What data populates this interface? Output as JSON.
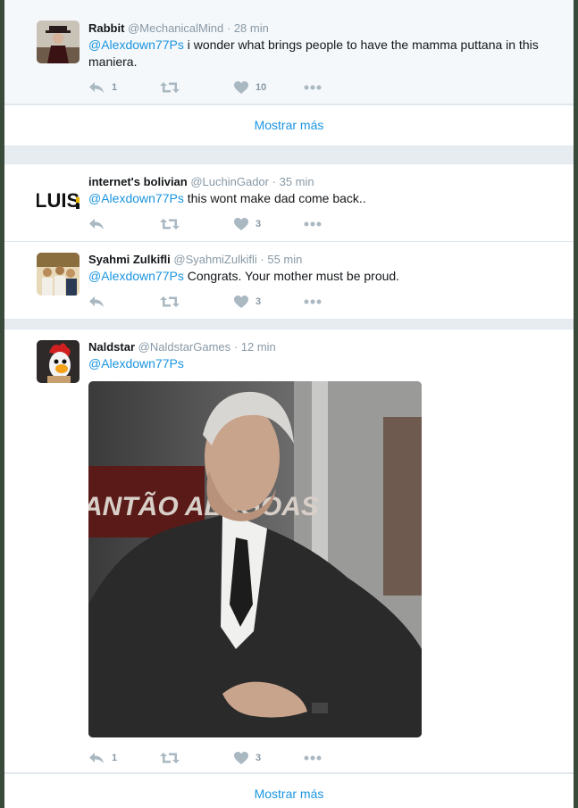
{
  "conversations": [
    {
      "tweets": [
        {
          "name": "Rabbit",
          "handle": "@MechanicalMind",
          "time": "28 min",
          "mention": "@Alexdown77Ps",
          "text": " i wonder what brings people to have the mamma puttana in this maniera.",
          "reply_count": "1",
          "retweet_count": "",
          "like_count": "10"
        }
      ],
      "show_more": "Mostrar más"
    },
    {
      "tweets": [
        {
          "name": "internet's bolivian",
          "handle": "@LuchinGador",
          "time": "35 min",
          "mention": "@Alexdown77Ps",
          "text": " this wont make dad come back..",
          "reply_count": "",
          "retweet_count": "",
          "like_count": "3",
          "avatar_text": "LUIS"
        },
        {
          "name": "Syahmi Zulkifli",
          "handle": "@SyahmiZulkifli",
          "time": "55 min",
          "mention": "@Alexdown77Ps",
          "text": " Congrats. Your mother must be proud.",
          "reply_count": "",
          "retweet_count": "",
          "like_count": "3"
        }
      ]
    },
    {
      "tweets": [
        {
          "name": "Naldstar",
          "handle": "@NaldstarGames",
          "time": "12 min",
          "mention": "@Alexdown77Ps",
          "text": "",
          "reply_count": "1",
          "retweet_count": "",
          "like_count": "3",
          "media_banner_text": "ANTÃO ALAGOAS"
        }
      ],
      "show_more": "Mostrar más"
    }
  ],
  "colors": {
    "link": "#1b95e0",
    "secondary_text": "#8899a6",
    "icon": "#aab8c2",
    "highlight_bg": "#f5f8fa"
  },
  "icons": [
    "reply-icon",
    "retweet-icon",
    "heart-icon",
    "more-icon"
  ]
}
